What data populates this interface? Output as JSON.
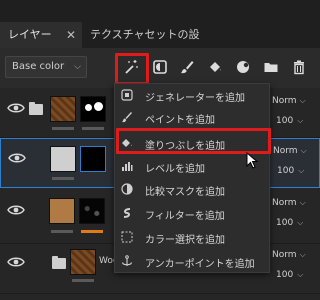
{
  "tabs": [
    {
      "label": "レイヤー",
      "active": true
    },
    {
      "label": "テクスチャセットの設定",
      "active": false
    }
  ],
  "toolbar": {
    "mode_select": "Base color",
    "icons": [
      "add-effect-magic-wand-icon",
      "add-mask-icon",
      "add-fill-layer-icon",
      "add-paint-layer-icon",
      "add-smart-material-icon",
      "add-folder-icon",
      "delete-icon"
    ]
  },
  "layers": [
    {
      "name_visible": "",
      "blend": "Norm",
      "opacity": "100"
    },
    {
      "name_visible": "",
      "blend": "Norm",
      "opacity": "100"
    },
    {
      "name_visible": "",
      "blend": "Norm",
      "opacity": "100"
    },
    {
      "name_visible": "Woo",
      "blend": "Norm",
      "opacity": "100"
    }
  ],
  "menu": {
    "items": [
      {
        "label": "ジェネレーターを追加",
        "icon": "generator-icon"
      },
      {
        "label": "ペイントを追加",
        "icon": "brush-icon"
      },
      {
        "label": "塗りつぶしを追加",
        "icon": "fill-bucket-icon"
      },
      {
        "label": "レベルを追加",
        "icon": "levels-icon"
      },
      {
        "label": "比較マスクを追加",
        "icon": "compare-mask-icon"
      },
      {
        "label": "フィルターを追加",
        "icon": "filter-icon"
      },
      {
        "label": "カラー選択を追加",
        "icon": "color-selection-icon"
      },
      {
        "label": "アンカーポイントを追加",
        "icon": "anchor-icon"
      }
    ]
  },
  "colors": {
    "highlight": "#e01b1b",
    "selection_border": "#2e7fd0",
    "panel_bg": "#2b2b2b",
    "menu_bg": "#2d2d2d"
  }
}
